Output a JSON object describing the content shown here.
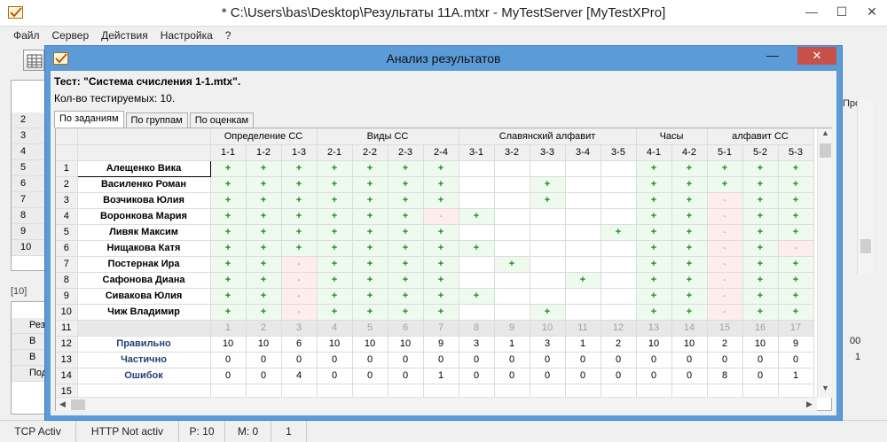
{
  "main": {
    "title": "* C:\\Users\\bas\\Desktop\\Результаты 11A.mtxr - MyTestServer [MyTestXPro]",
    "minimize": "—",
    "maximize": "☐",
    "close": "✕",
    "menu": [
      "Файл",
      "Сервер",
      "Действия",
      "Настройка",
      "?"
    ]
  },
  "background": {
    "rows": [
      "2",
      "3",
      "4",
      "5",
      "6",
      "7",
      "8",
      "9",
      "10"
    ],
    "left_label": "[10]  ",
    "lower_rows": [
      "Рез",
      "В",
      "В",
      "Под",
      ""
    ],
    "right_cells": [
      "Про",
      "00",
      "1"
    ]
  },
  "statusbar": [
    "TCP Activ",
    "HTTP Not activ",
    "P: 10",
    "M: 0",
    "1"
  ],
  "dialog": {
    "title": "Анализ результатов",
    "close": "✕",
    "minimize": "—",
    "test_line": "Тест: \"Система счисления 1-1.mtx\".",
    "count_line": "Кол-во тестируемых: 10.",
    "tabs": [
      "По заданиям",
      "По группам",
      "По оценкам"
    ],
    "groups": [
      {
        "label": "Определение СС",
        "span": 3
      },
      {
        "label": "Виды СС",
        "span": 4
      },
      {
        "label": "Славянский алфавит",
        "span": 5
      },
      {
        "label": "Часы",
        "span": 2
      },
      {
        "label": "алфавит СС",
        "span": 3
      }
    ],
    "columns": [
      "1-1",
      "1-2",
      "1-3",
      "2-1",
      "2-2",
      "2-3",
      "2-4",
      "3-1",
      "3-2",
      "3-3",
      "3-4",
      "3-5",
      "4-1",
      "4-2",
      "5-1",
      "5-2",
      "5-3"
    ],
    "rows": [
      {
        "n": "1",
        "name": "Алещенко Вика",
        "cells": "+++++++_____++ +++"
      },
      {
        "n": "2",
        "name": "Василенко Роман",
        "cells": "+++++++__+__+++++"
      },
      {
        "n": "3",
        "name": "Возчикова Юлия",
        "cells": "+++++++__+__++-++"
      },
      {
        "n": "4",
        "name": "Воронкова Мария",
        "cells": "++++++-+____++-++"
      },
      {
        "n": "5",
        "name": "Ливяк Максим",
        "cells": "+++++++____+++-++"
      },
      {
        "n": "6",
        "name": "Нищакова Катя",
        "cells": "+++++++ +____++-+-"
      },
      {
        "n": "7",
        "name": "Постернак Ира",
        "cells": "++-++++_+___++-++"
      },
      {
        "n": "8",
        "name": "Сафонова Диана",
        "cells": "++-++++___+_++-++"
      },
      {
        "n": "9",
        "name": "Сивакова Юлия",
        "cells": "++-++++ +____++-++"
      },
      {
        "n": "10",
        "name": "Чиж Владимир",
        "cells": "++-++++__+__++-++"
      }
    ],
    "index_row": {
      "n": "11",
      "values": [
        "1",
        "2",
        "3",
        "4",
        "5",
        "6",
        "7",
        "8",
        "9",
        "10",
        "11",
        "12",
        "13",
        "14",
        "15",
        "16",
        "17"
      ]
    },
    "stats": [
      {
        "n": "12",
        "name": "Правильно",
        "values": [
          "10",
          "10",
          "6",
          "10",
          "10",
          "10",
          "9",
          "3",
          "1",
          "3",
          "1",
          "2",
          "10",
          "10",
          "2",
          "10",
          "9"
        ]
      },
      {
        "n": "13",
        "name": "Частично",
        "values": [
          "0",
          "0",
          "0",
          "0",
          "0",
          "0",
          "0",
          "0",
          "0",
          "0",
          "0",
          "0",
          "0",
          "0",
          "0",
          "0",
          "0"
        ]
      },
      {
        "n": "14",
        "name": "Ошибок",
        "values": [
          "0",
          "0",
          "4",
          "0",
          "0",
          "0",
          "1",
          "0",
          "0",
          "0",
          "0",
          "0",
          "0",
          "0",
          "8",
          "0",
          "1"
        ]
      },
      {
        "n": "15",
        "name": "",
        "values": [
          "",
          "",
          "",
          "",
          "",
          "",
          "",
          "",
          "",
          "",
          "",
          "",
          "",
          "",
          "",
          "",
          ""
        ]
      }
    ]
  }
}
